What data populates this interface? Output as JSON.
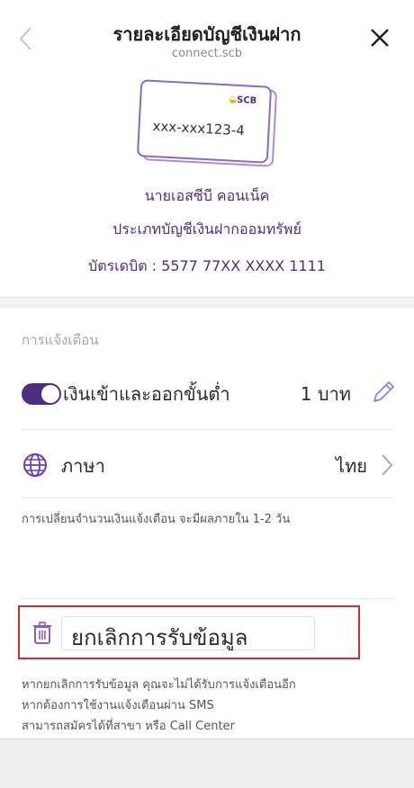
{
  "header": {
    "title": "รายละเอียดบัญชีเงินฝาก",
    "subtitle": "connect.scb"
  },
  "card": {
    "logo": "SCB",
    "number": "xxx-xxx123-4"
  },
  "account": {
    "name": "นายเอสซีบี คอนเน็ค",
    "type": "ประเภทบัญชีเงินฝากออมทรัพย์",
    "debit": "บัตรเดบิต : 5577 77XX XXXX 1111"
  },
  "notifications": {
    "section_label": "การแจ้งเตือน",
    "threshold_label": "เงินเข้าและออกขั้นต่ำ",
    "threshold_value": "1 บาท",
    "toggle_on": true,
    "language_label": "ภาษา",
    "language_value": "ไทย",
    "note": "การเปลี่ยนจำนวนเงินแจ้งเตือน จะมีผลภายใน 1-2 วัน"
  },
  "cancel": {
    "label": "ยกเลิกการรับข้อมูล"
  },
  "footnote": {
    "line1": "หากยกเลิกการรับข้อมูล คุณจะไม่ได้รับการแจ้งเตือนอีก",
    "line2": "หากต้องการใช้งานแจ้งเตือนผ่าน SMS",
    "line3": "สามารถสมัครได้ที่สาขา หรือ Call Center"
  },
  "colors": {
    "brand_purple": "#4f2d7f",
    "highlight_red": "#d8292f"
  },
  "icons": [
    "back-icon",
    "close-icon",
    "pencil-icon",
    "globe-icon",
    "chevron-right-icon",
    "trash-icon"
  ]
}
